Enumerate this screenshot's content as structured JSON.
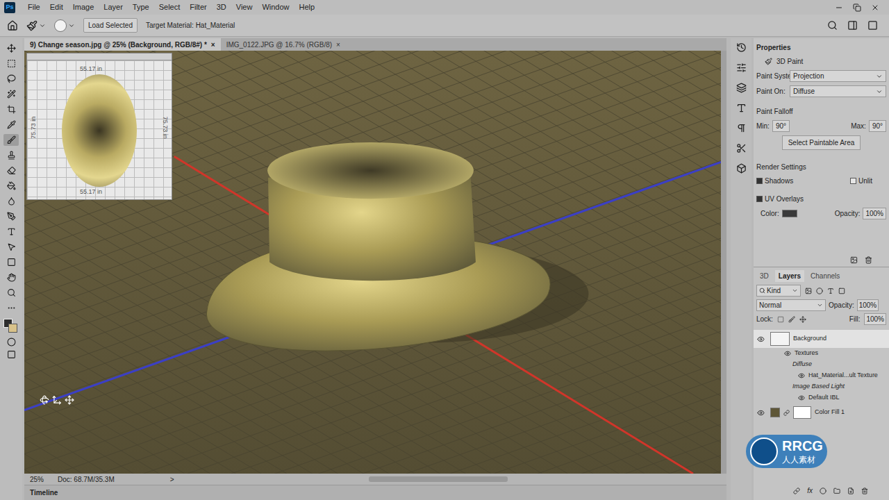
{
  "app": {
    "logo": "Ps"
  },
  "menu": [
    "File",
    "Edit",
    "Image",
    "Layer",
    "Type",
    "Select",
    "Filter",
    "3D",
    "View",
    "Window",
    "Help"
  ],
  "options_bar": {
    "load_button": "Load Selected",
    "target": "Target Material: Hat_Material"
  },
  "doc_tabs": [
    {
      "label": "9) Change season.jpg @ 25% (Background, RGB/8#) *",
      "close": "×",
      "selected": true
    },
    {
      "label": "IMG_0122.JPG @ 16.7% (RGB/8)",
      "close": "×",
      "selected": false
    }
  ],
  "uv_overlay": {
    "top": "55.17 in",
    "bottom": "55.17 in",
    "left": "75.73 in",
    "right": "75.73 in"
  },
  "status_bar": {
    "zoom": "25%",
    "doc": "Doc: 68.7M/35.3M",
    "arrow": ">"
  },
  "timeline": {
    "label": "Timeline"
  },
  "properties": {
    "title": "Properties",
    "section": "3D Paint",
    "selects": [
      {
        "label": "Paint System:",
        "value": "Projection"
      },
      {
        "label": "Paint On:",
        "value": "Diffuse"
      }
    ],
    "falloff": {
      "title": "Paint Falloff",
      "min_label": "Min:",
      "min": "90°",
      "max_label": "Max:",
      "max": "90°"
    },
    "button": "Select Paintable Area",
    "render": {
      "title": "Render Settings",
      "shadows": {
        "label": "Shadows",
        "checked": true
      },
      "unlit": {
        "label": "Unlit",
        "checked": false
      }
    },
    "uv": {
      "label": "UV Overlays",
      "checked": true,
      "color_label": "Color:",
      "color": "#3a3a3a",
      "opacity_label": "Opacity:",
      "opacity": "100%"
    }
  },
  "layers_panel": {
    "tabs": [
      {
        "label": "3D",
        "selected": false
      },
      {
        "label": "Layers",
        "selected": true
      },
      {
        "label": "Channels",
        "selected": false
      }
    ],
    "filter": "Kind",
    "blend": "Normal",
    "opacity_label": "Opacity:",
    "opacity": "100%",
    "lock_label": "Lock:",
    "fill_label": "Fill:",
    "fill": "100%",
    "layers": [
      {
        "name": "Background",
        "kind": "layer",
        "visible": true,
        "selected": true
      },
      {
        "name": "Textures",
        "kind": "group",
        "visible": true,
        "selected": false
      },
      {
        "name": "Diffuse",
        "kind": "heading",
        "visible": false,
        "selected": false
      },
      {
        "name": "Hat_Material...ult Texture",
        "kind": "item",
        "visible": true,
        "selected": false
      },
      {
        "name": "Image Based Light",
        "kind": "heading",
        "visible": false,
        "selected": false
      },
      {
        "name": "Default IBL",
        "kind": "item",
        "visible": true,
        "selected": false
      },
      {
        "name": "Color Fill 1",
        "kind": "fill",
        "visible": true,
        "selected": false
      }
    ],
    "fx": "fx"
  },
  "watermark": {
    "name": "RRCG",
    "cn": "人人素材"
  }
}
